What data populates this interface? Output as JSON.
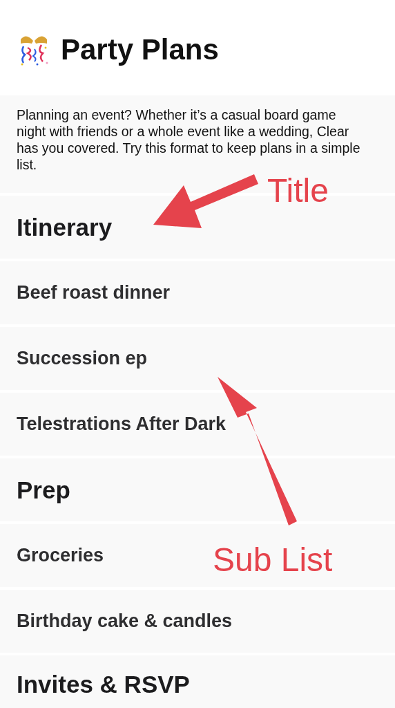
{
  "list": {
    "title": "Party Plans",
    "description": "Planning an event? Whether it’s a casual board game night with friends or a whole event like a wedding, Clear has you covered. Try this format to keep plans in a simple list.",
    "rows": [
      {
        "kind": "title",
        "label": "Itinerary"
      },
      {
        "kind": "item",
        "label": "Beef roast dinner"
      },
      {
        "kind": "item",
        "label": "Succession ep"
      },
      {
        "kind": "item",
        "label": "Telestrations After Dark"
      },
      {
        "kind": "title",
        "label": "Prep"
      },
      {
        "kind": "item",
        "label": "Groceries"
      },
      {
        "kind": "item",
        "label": "Birthday cake & candles"
      },
      {
        "kind": "title",
        "label": "Invites & RSVP"
      }
    ]
  },
  "annotations": [
    {
      "text": "Title"
    },
    {
      "text": "Sub List"
    }
  ]
}
